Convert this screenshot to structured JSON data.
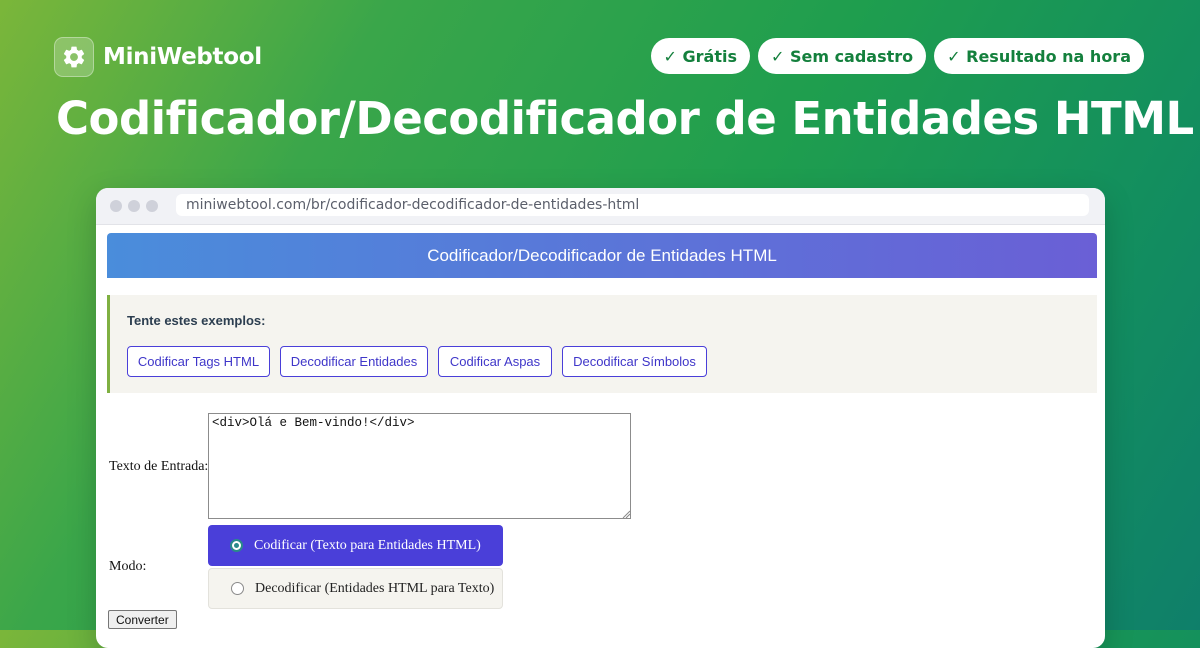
{
  "brand": {
    "name": "MiniWebtool",
    "logo_icon": "gear-icon"
  },
  "badges": [
    "✓ Grátis",
    "✓ Sem cadastro",
    "✓ Resultado na hora"
  ],
  "hero_title": "Codificador/Decodificador de Entidades HTML",
  "browser": {
    "url": "miniwebtool.com/br/codificador-decodificador-de-entidades-html"
  },
  "tool": {
    "header_title": "Codificador/Decodificador de Entidades HTML",
    "examples_title": "Tente estes exemplos:",
    "examples": [
      "Codificar Tags HTML",
      "Decodificar Entidades",
      "Codificar Aspas",
      "Decodificar Símbolos"
    ],
    "input_label": "Texto de Entrada:",
    "input_value": "<div>Olá e Bem-vindo!</div>",
    "mode_label": "Modo:",
    "modes": [
      "Codificar (Texto para Entidades HTML)",
      "Decodificar (Entidades HTML para Texto)"
    ],
    "selected_mode": "Codificar (Texto para Entidades HTML)",
    "convert_label": "Converter"
  },
  "colors": {
    "accent_purple": "#4a3fd9",
    "badge_text_green": "#14803d",
    "example_border_green": "#7fb041",
    "header_gradient_start": "#4a8ddb",
    "header_gradient_end": "#6a5fd6"
  }
}
